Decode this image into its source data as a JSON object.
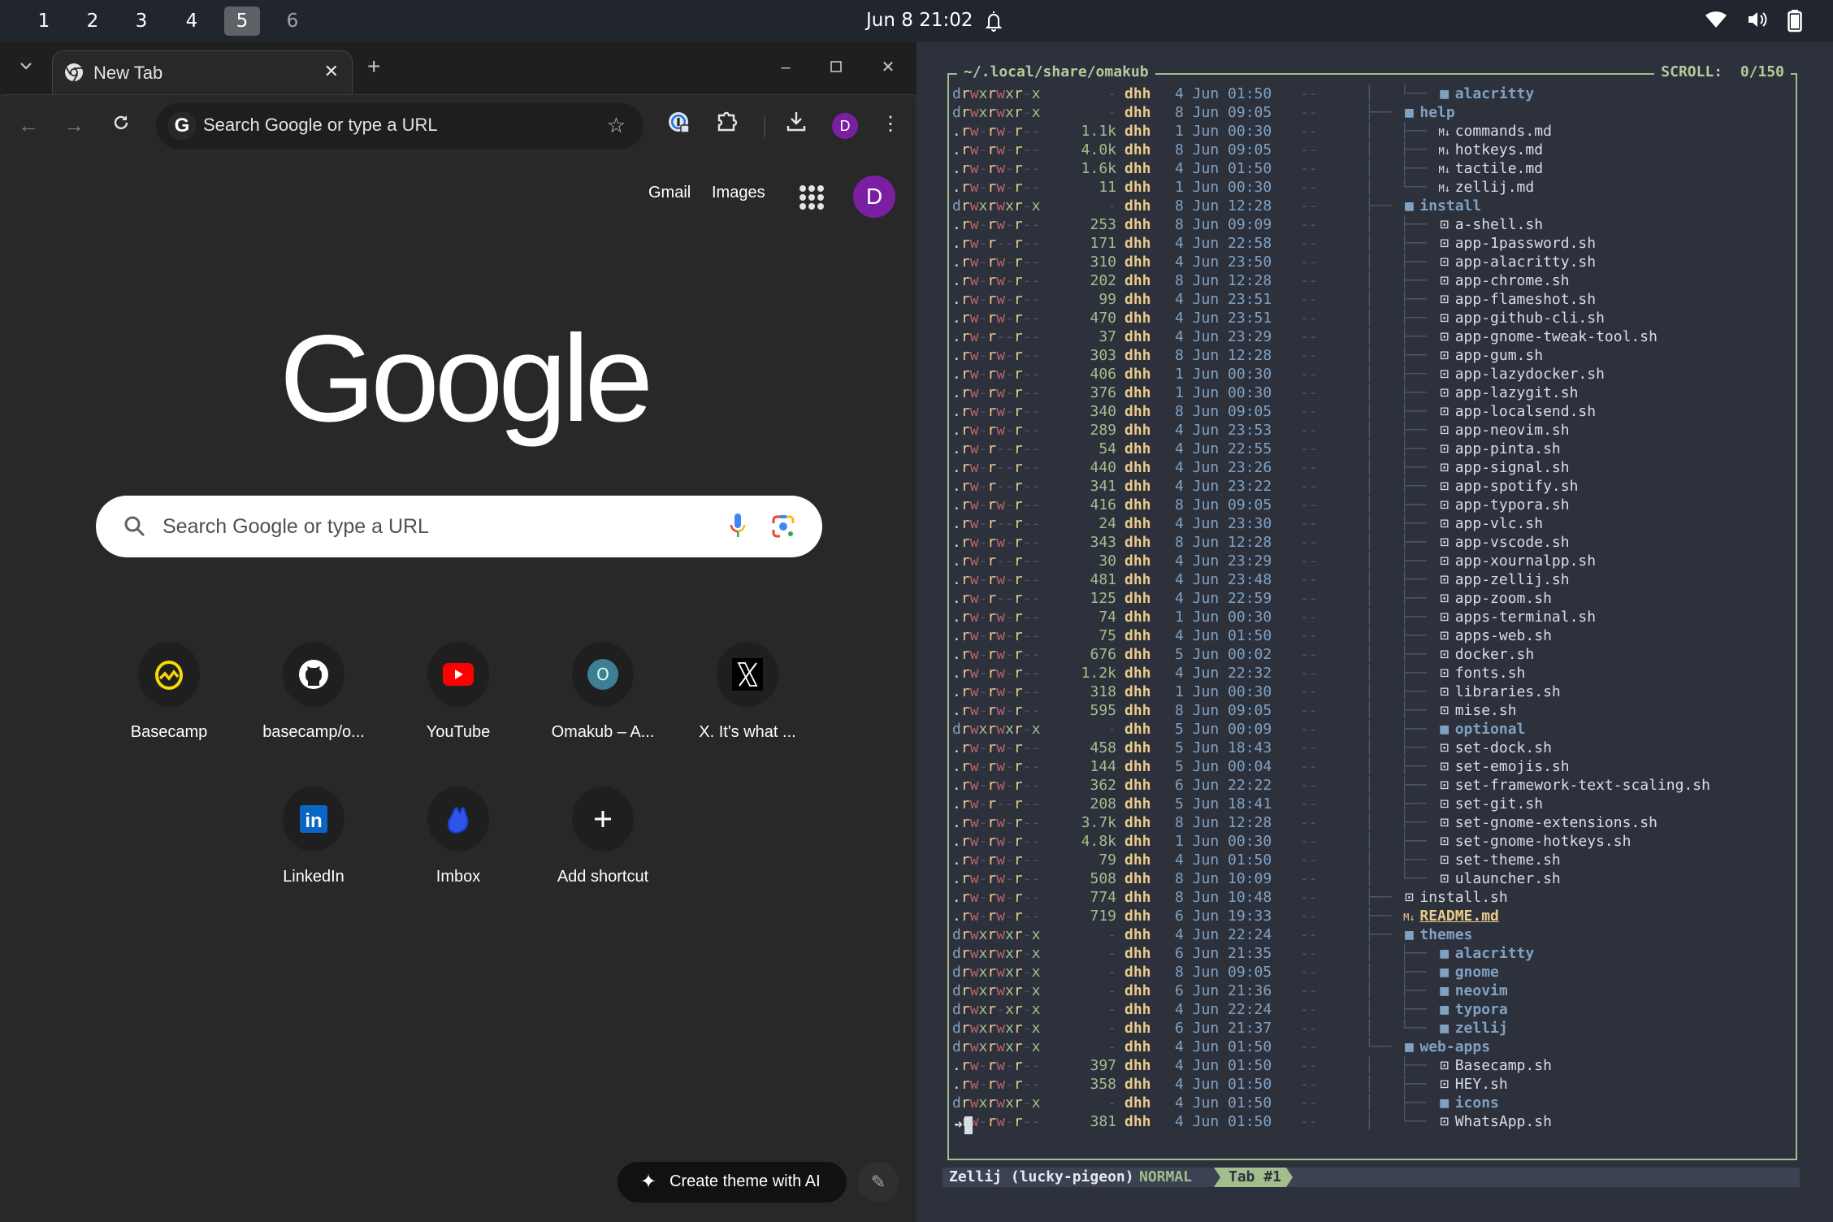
{
  "topbar": {
    "workspaces": [
      {
        "label": "1",
        "active": false
      },
      {
        "label": "2",
        "active": false
      },
      {
        "label": "3",
        "active": false
      },
      {
        "label": "4",
        "active": false
      },
      {
        "label": "5",
        "active": true
      },
      {
        "label": "6",
        "active": false
      }
    ],
    "clock": "Jun 8  21:02",
    "tray_icons": [
      "bell-icon",
      "wifi-icon",
      "volume-icon",
      "battery-icon"
    ]
  },
  "chrome": {
    "tab": {
      "title": "New Tab"
    },
    "omnibox": {
      "placeholder": "Search Google or type a URL"
    },
    "profile_initial": "D",
    "page": {
      "top_links": [
        "Gmail",
        "Images"
      ],
      "avatar_initial": "D",
      "logo_text": "Google",
      "search_placeholder": "Search Google or type a URL",
      "shortcuts": [
        {
          "label": "Basecamp",
          "icon": "basecamp-icon"
        },
        {
          "label": "basecamp/o...",
          "icon": "github-icon"
        },
        {
          "label": "YouTube",
          "icon": "youtube-icon"
        },
        {
          "label": "Omakub – A...",
          "icon": "omakub-icon"
        },
        {
          "label": "X. It's what ...",
          "icon": "x-icon"
        },
        {
          "label": "LinkedIn",
          "icon": "linkedin-icon"
        },
        {
          "label": "Imbox",
          "icon": "hey-icon"
        },
        {
          "label": "Add shortcut",
          "icon": "plus-icon"
        }
      ],
      "ai_theme_label": "Create theme with AI"
    }
  },
  "terminal": {
    "pane_title": "~/.local/share/omakub",
    "scroll": "SCROLL:  0/150",
    "rows": [
      {
        "perm": "drwxrwxr-x",
        "size": "-",
        "user": "dhh",
        "date": "4 Jun 01:50",
        "git": "--",
        "depth": 1,
        "last": true,
        "type": "dir",
        "name": "alacritty"
      },
      {
        "perm": "drwxrwxr-x",
        "size": "-",
        "user": "dhh",
        "date": "8 Jun 09:05",
        "git": "--",
        "depth": 0,
        "type": "dir",
        "name": "help"
      },
      {
        "perm": ".rw-rw-r--",
        "size": "1.1k",
        "user": "dhh",
        "date": "1 Jun 00:30",
        "git": "--",
        "depth": 1,
        "type": "md",
        "name": "commands.md"
      },
      {
        "perm": ".rw-rw-r--",
        "size": "4.0k",
        "user": "dhh",
        "date": "8 Jun 09:05",
        "git": "--",
        "depth": 1,
        "type": "md",
        "name": "hotkeys.md"
      },
      {
        "perm": ".rw-rw-r--",
        "size": "1.6k",
        "user": "dhh",
        "date": "4 Jun 01:50",
        "git": "--",
        "depth": 1,
        "type": "md",
        "name": "tactile.md"
      },
      {
        "perm": ".rw-rw-r--",
        "size": "11",
        "user": "dhh",
        "date": "1 Jun 00:30",
        "git": "--",
        "depth": 1,
        "last": true,
        "type": "md",
        "name": "zellij.md"
      },
      {
        "perm": "drwxrwxr-x",
        "size": "-",
        "user": "dhh",
        "date": "8 Jun 12:28",
        "git": "--",
        "depth": 0,
        "type": "dir",
        "name": "install"
      },
      {
        "perm": ".rw-rw-r--",
        "size": "253",
        "user": "dhh",
        "date": "8 Jun 09:09",
        "git": "--",
        "depth": 1,
        "type": "sh",
        "name": "a-shell.sh"
      },
      {
        "perm": ".rw-r--r--",
        "size": "171",
        "user": "dhh",
        "date": "4 Jun 22:58",
        "git": "--",
        "depth": 1,
        "type": "sh",
        "name": "app-1password.sh"
      },
      {
        "perm": ".rw-rw-r--",
        "size": "310",
        "user": "dhh",
        "date": "4 Jun 23:50",
        "git": "--",
        "depth": 1,
        "type": "sh",
        "name": "app-alacritty.sh"
      },
      {
        "perm": ".rw-rw-r--",
        "size": "202",
        "user": "dhh",
        "date": "8 Jun 12:28",
        "git": "--",
        "depth": 1,
        "type": "sh",
        "name": "app-chrome.sh"
      },
      {
        "perm": ".rw-rw-r--",
        "size": "99",
        "user": "dhh",
        "date": "4 Jun 23:51",
        "git": "--",
        "depth": 1,
        "type": "sh",
        "name": "app-flameshot.sh"
      },
      {
        "perm": ".rw-rw-r--",
        "size": "470",
        "user": "dhh",
        "date": "4 Jun 23:51",
        "git": "--",
        "depth": 1,
        "type": "sh",
        "name": "app-github-cli.sh"
      },
      {
        "perm": ".rw-r--r--",
        "size": "37",
        "user": "dhh",
        "date": "4 Jun 23:29",
        "git": "--",
        "depth": 1,
        "type": "sh",
        "name": "app-gnome-tweak-tool.sh"
      },
      {
        "perm": ".rw-rw-r--",
        "size": "303",
        "user": "dhh",
        "date": "8 Jun 12:28",
        "git": "--",
        "depth": 1,
        "type": "sh",
        "name": "app-gum.sh"
      },
      {
        "perm": ".rw-rw-r--",
        "size": "406",
        "user": "dhh",
        "date": "1 Jun 00:30",
        "git": "--",
        "depth": 1,
        "type": "sh",
        "name": "app-lazydocker.sh"
      },
      {
        "perm": ".rw-rw-r--",
        "size": "376",
        "user": "dhh",
        "date": "1 Jun 00:30",
        "git": "--",
        "depth": 1,
        "type": "sh",
        "name": "app-lazygit.sh"
      },
      {
        "perm": ".rw-rw-r--",
        "size": "340",
        "user": "dhh",
        "date": "8 Jun 09:05",
        "git": "--",
        "depth": 1,
        "type": "sh",
        "name": "app-localsend.sh"
      },
      {
        "perm": ".rw-rw-r--",
        "size": "289",
        "user": "dhh",
        "date": "4 Jun 23:53",
        "git": "--",
        "depth": 1,
        "type": "sh",
        "name": "app-neovim.sh"
      },
      {
        "perm": ".rw-r--r--",
        "size": "54",
        "user": "dhh",
        "date": "4 Jun 22:55",
        "git": "--",
        "depth": 1,
        "type": "sh",
        "name": "app-pinta.sh"
      },
      {
        "perm": ".rw-r--r--",
        "size": "440",
        "user": "dhh",
        "date": "4 Jun 23:26",
        "git": "--",
        "depth": 1,
        "type": "sh",
        "name": "app-signal.sh"
      },
      {
        "perm": ".rw-r--r--",
        "size": "341",
        "user": "dhh",
        "date": "4 Jun 23:22",
        "git": "--",
        "depth": 1,
        "type": "sh",
        "name": "app-spotify.sh"
      },
      {
        "perm": ".rw-rw-r--",
        "size": "416",
        "user": "dhh",
        "date": "8 Jun 09:05",
        "git": "--",
        "depth": 1,
        "type": "sh",
        "name": "app-typora.sh"
      },
      {
        "perm": ".rw-r--r--",
        "size": "24",
        "user": "dhh",
        "date": "4 Jun 23:30",
        "git": "--",
        "depth": 1,
        "type": "sh",
        "name": "app-vlc.sh"
      },
      {
        "perm": ".rw-rw-r--",
        "size": "343",
        "user": "dhh",
        "date": "8 Jun 12:28",
        "git": "--",
        "depth": 1,
        "type": "sh",
        "name": "app-vscode.sh"
      },
      {
        "perm": ".rw-r--r--",
        "size": "30",
        "user": "dhh",
        "date": "4 Jun 23:29",
        "git": "--",
        "depth": 1,
        "type": "sh",
        "name": "app-xournalpp.sh"
      },
      {
        "perm": ".rw-rw-r--",
        "size": "481",
        "user": "dhh",
        "date": "4 Jun 23:48",
        "git": "--",
        "depth": 1,
        "type": "sh",
        "name": "app-zellij.sh"
      },
      {
        "perm": ".rw-r--r--",
        "size": "125",
        "user": "dhh",
        "date": "4 Jun 22:59",
        "git": "--",
        "depth": 1,
        "type": "sh",
        "name": "app-zoom.sh"
      },
      {
        "perm": ".rw-rw-r--",
        "size": "74",
        "user": "dhh",
        "date": "1 Jun 00:30",
        "git": "--",
        "depth": 1,
        "type": "sh",
        "name": "apps-terminal.sh"
      },
      {
        "perm": ".rw-rw-r--",
        "size": "75",
        "user": "dhh",
        "date": "4 Jun 01:50",
        "git": "--",
        "depth": 1,
        "type": "sh",
        "name": "apps-web.sh"
      },
      {
        "perm": ".rw-rw-r--",
        "size": "676",
        "user": "dhh",
        "date": "5 Jun 00:02",
        "git": "--",
        "depth": 1,
        "type": "sh",
        "name": "docker.sh"
      },
      {
        "perm": ".rw-rw-r--",
        "size": "1.2k",
        "user": "dhh",
        "date": "4 Jun 22:32",
        "git": "--",
        "depth": 1,
        "type": "sh",
        "name": "fonts.sh"
      },
      {
        "perm": ".rw-rw-r--",
        "size": "318",
        "user": "dhh",
        "date": "1 Jun 00:30",
        "git": "--",
        "depth": 1,
        "type": "sh",
        "name": "libraries.sh"
      },
      {
        "perm": ".rw-rw-r--",
        "size": "595",
        "user": "dhh",
        "date": "8 Jun 09:05",
        "git": "--",
        "depth": 1,
        "type": "sh",
        "name": "mise.sh"
      },
      {
        "perm": "drwxrwxr-x",
        "size": "-",
        "user": "dhh",
        "date": "5 Jun 00:09",
        "git": "--",
        "depth": 1,
        "type": "dir",
        "name": "optional"
      },
      {
        "perm": ".rw-rw-r--",
        "size": "458",
        "user": "dhh",
        "date": "5 Jun 18:43",
        "git": "--",
        "depth": 1,
        "type": "sh",
        "name": "set-dock.sh"
      },
      {
        "perm": ".rw-rw-r--",
        "size": "144",
        "user": "dhh",
        "date": "5 Jun 00:04",
        "git": "--",
        "depth": 1,
        "type": "sh",
        "name": "set-emojis.sh"
      },
      {
        "perm": ".rw-rw-r--",
        "size": "362",
        "user": "dhh",
        "date": "6 Jun 22:22",
        "git": "--",
        "depth": 1,
        "type": "sh",
        "name": "set-framework-text-scaling.sh"
      },
      {
        "perm": ".rw-r--r--",
        "size": "208",
        "user": "dhh",
        "date": "5 Jun 18:41",
        "git": "--",
        "depth": 1,
        "type": "sh",
        "name": "set-git.sh"
      },
      {
        "perm": ".rw-rw-r--",
        "size": "3.7k",
        "user": "dhh",
        "date": "8 Jun 12:28",
        "git": "--",
        "depth": 1,
        "type": "sh",
        "name": "set-gnome-extensions.sh"
      },
      {
        "perm": ".rw-rw-r--",
        "size": "4.8k",
        "user": "dhh",
        "date": "1 Jun 00:30",
        "git": "--",
        "depth": 1,
        "type": "sh",
        "name": "set-gnome-hotkeys.sh"
      },
      {
        "perm": ".rw-rw-r--",
        "size": "79",
        "user": "dhh",
        "date": "4 Jun 01:50",
        "git": "--",
        "depth": 1,
        "type": "sh",
        "name": "set-theme.sh"
      },
      {
        "perm": ".rw-rw-r--",
        "size": "508",
        "user": "dhh",
        "date": "8 Jun 10:09",
        "git": "--",
        "depth": 1,
        "last": true,
        "type": "sh",
        "name": "ulauncher.sh"
      },
      {
        "perm": ".rw-rw-r--",
        "size": "774",
        "user": "dhh",
        "date": "8 Jun 10:48",
        "git": "--",
        "depth": 0,
        "type": "sh",
        "name": "install.sh"
      },
      {
        "perm": ".rw-rw-r--",
        "size": "719",
        "user": "dhh",
        "date": "6 Jun 19:33",
        "git": "--",
        "depth": 0,
        "type": "readme",
        "name": "README.md"
      },
      {
        "perm": "drwxrwxr-x",
        "size": "-",
        "user": "dhh",
        "date": "4 Jun 22:24",
        "git": "--",
        "depth": 0,
        "type": "dir",
        "name": "themes"
      },
      {
        "perm": "drwxrwxr-x",
        "size": "-",
        "user": "dhh",
        "date": "6 Jun 21:35",
        "git": "--",
        "depth": 1,
        "type": "dir",
        "name": "alacritty"
      },
      {
        "perm": "drwxrwxr-x",
        "size": "-",
        "user": "dhh",
        "date": "8 Jun 09:05",
        "git": "--",
        "depth": 1,
        "type": "dir",
        "name": "gnome"
      },
      {
        "perm": "drwxrwxr-x",
        "size": "-",
        "user": "dhh",
        "date": "6 Jun 21:36",
        "git": "--",
        "depth": 1,
        "type": "dir",
        "name": "neovim"
      },
      {
        "perm": "drwxr-xr-x",
        "size": "-",
        "user": "dhh",
        "date": "4 Jun 22:24",
        "git": "--",
        "depth": 1,
        "type": "dir",
        "name": "typora"
      },
      {
        "perm": "drwxrwxr-x",
        "size": "-",
        "user": "dhh",
        "date": "6 Jun 21:37",
        "git": "--",
        "depth": 1,
        "last": true,
        "type": "dir",
        "name": "zellij"
      },
      {
        "perm": "drwxrwxr-x",
        "size": "-",
        "user": "dhh",
        "date": "4 Jun 01:50",
        "git": "--",
        "depth": 0,
        "last": true,
        "type": "dir",
        "name": "web-apps"
      },
      {
        "perm": ".rw-rw-r--",
        "size": "397",
        "user": "dhh",
        "date": "4 Jun 01:50",
        "git": "--",
        "depth": 1,
        "type": "sh",
        "name": "Basecamp.sh"
      },
      {
        "perm": ".rw-rw-r--",
        "size": "358",
        "user": "dhh",
        "date": "4 Jun 01:50",
        "git": "--",
        "depth": 1,
        "type": "sh",
        "name": "HEY.sh"
      },
      {
        "perm": "drwxrwxr-x",
        "size": "-",
        "user": "dhh",
        "date": "4 Jun 01:50",
        "git": "--",
        "depth": 1,
        "type": "dir",
        "name": "icons"
      },
      {
        "perm": ".rw-rw-r--",
        "size": "381",
        "user": "dhh",
        "date": "4 Jun 01:50",
        "git": "--",
        "depth": 1,
        "last": true,
        "type": "sh",
        "name": "WhatsApp.sh"
      }
    ],
    "status": {
      "session": "Zellij (lucky-pigeon)",
      "mode": "NORMAL",
      "tab": "Tab #1"
    }
  },
  "colors": {
    "accent_green": "#a3be8c",
    "perm_dir": "#81a1c1",
    "perm_read": "#ebcb8b",
    "perm_write": "#bf616a",
    "perm_exec": "#a3be8c",
    "avatar_purple": "#7b1fa2"
  }
}
